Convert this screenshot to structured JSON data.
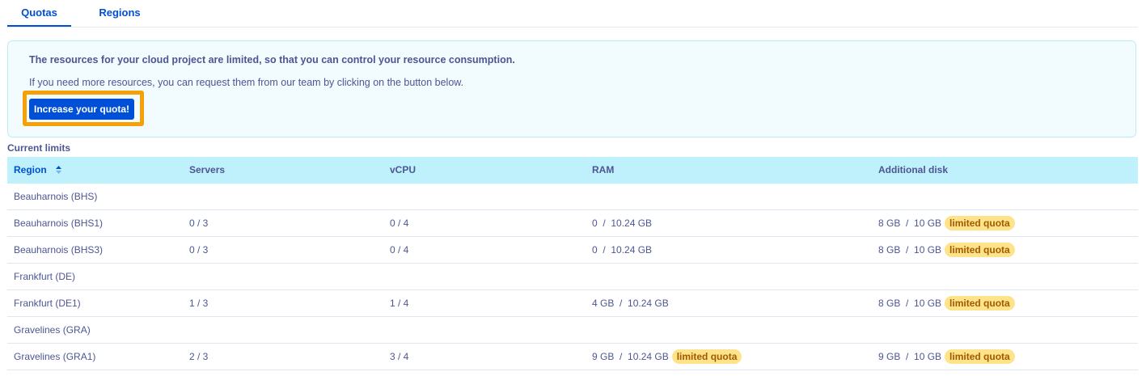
{
  "tabs": [
    {
      "label": "Quotas",
      "active": true
    },
    {
      "label": "Regions",
      "active": false
    }
  ],
  "info": {
    "title": "The resources for your cloud project are limited, so that you can control your resource consumption.",
    "text": "If you need more resources, you can request them from our team by clicking on the button below.",
    "button_label": "Increase your quota!"
  },
  "section_label": "Current limits",
  "table": {
    "headers": {
      "region": "Region",
      "servers": "Servers",
      "vcpu": "vCPU",
      "ram": "RAM",
      "disk": "Additional disk"
    },
    "badge_label": "limited quota",
    "rows": [
      {
        "region": "Beauharnois (BHS)",
        "servers": "",
        "vcpu": "",
        "ram": "",
        "ram_limited": "",
        "disk": "",
        "disk_limited": ""
      },
      {
        "region": "Beauharnois (BHS1)",
        "servers": "0 / 3",
        "vcpu": "0 / 4",
        "ram": "0  /  10.24 GB",
        "ram_limited": "",
        "disk": "8 GB  /  10 GB",
        "disk_limited": "limited quota"
      },
      {
        "region": "Beauharnois (BHS3)",
        "servers": "0 / 3",
        "vcpu": "0 / 4",
        "ram": "0  /  10.24 GB",
        "ram_limited": "",
        "disk": "8 GB  /  10 GB",
        "disk_limited": "limited quota"
      },
      {
        "region": "Frankfurt (DE)",
        "servers": "",
        "vcpu": "",
        "ram": "",
        "ram_limited": "",
        "disk": "",
        "disk_limited": ""
      },
      {
        "region": "Frankfurt (DE1)",
        "servers": "1 / 3",
        "vcpu": "1 / 4",
        "ram": "4 GB  /  10.24 GB",
        "ram_limited": "",
        "disk": "8 GB  /  10 GB",
        "disk_limited": "limited quota"
      },
      {
        "region": "Gravelines (GRA)",
        "servers": "",
        "vcpu": "",
        "ram": "",
        "ram_limited": "",
        "disk": "",
        "disk_limited": ""
      },
      {
        "region": "Gravelines (GRA1)",
        "servers": "2 / 3",
        "vcpu": "3 / 4",
        "ram": "9 GB  /  10.24 GB",
        "ram_limited": "limited quota",
        "disk": "9 GB  /  10 GB",
        "disk_limited": "limited quota"
      }
    ]
  },
  "colors": {
    "primary": "#0050d7",
    "text": "#4d5693",
    "header_bg": "#bef1fb",
    "info_bg": "#f2fbfd",
    "highlight": "#f5a007",
    "badge_bg": "#ffe38a"
  },
  "icons": {
    "sort": "sort-icon"
  }
}
